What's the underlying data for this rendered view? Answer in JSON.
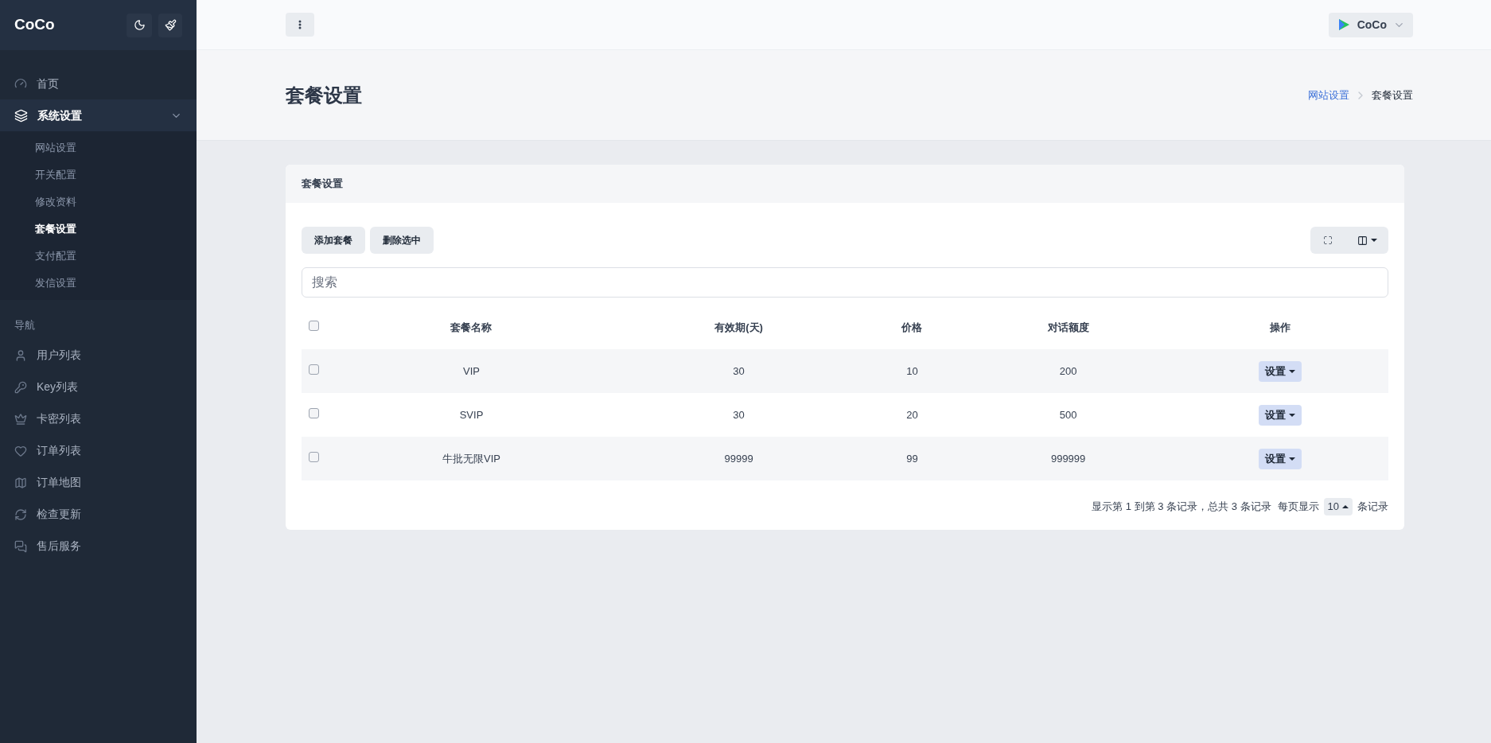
{
  "sidebar": {
    "brand": "CoCo",
    "items": [
      {
        "kind": "link",
        "label": "首页",
        "selected": false
      },
      {
        "kind": "group",
        "label": "系统设置",
        "expanded": true,
        "children": [
          {
            "label": "网站设置",
            "selected": false
          },
          {
            "label": "开关配置",
            "selected": false
          },
          {
            "label": "修改资料",
            "selected": false
          },
          {
            "label": "套餐设置",
            "selected": true
          },
          {
            "label": "支付配置",
            "selected": false
          },
          {
            "label": "发信设置",
            "selected": false
          }
        ]
      },
      {
        "kind": "heading",
        "label": "导航"
      },
      {
        "kind": "link",
        "label": "用户列表",
        "selected": false
      },
      {
        "kind": "link",
        "label": "Key列表",
        "selected": false
      },
      {
        "kind": "link",
        "label": "卡密列表",
        "selected": false
      },
      {
        "kind": "link",
        "label": "订单列表",
        "selected": false
      },
      {
        "kind": "link",
        "label": "订单地图",
        "selected": false
      },
      {
        "kind": "link",
        "label": "检查更新",
        "selected": false
      },
      {
        "kind": "link",
        "label": "售后服务",
        "selected": false
      }
    ]
  },
  "topbar": {
    "user": "CoCo"
  },
  "page": {
    "title": "套餐设置",
    "breadcrumb": [
      {
        "label": "网站设置",
        "link": true
      },
      {
        "label": "套餐设置",
        "link": false
      }
    ]
  },
  "card": {
    "title": "套餐设置",
    "buttons": [
      "添加套餐",
      "删除选中"
    ],
    "search": {
      "placeholder": "搜索"
    },
    "table": {
      "select_all": {
        "checked": false
      },
      "columns": [
        "套餐名称",
        "有效期(天)",
        "价格",
        "对话额度",
        "操作"
      ],
      "rows": [
        {
          "checked": false,
          "cells": [
            "VIP",
            "30",
            "10",
            "200"
          ],
          "action": "设置"
        },
        {
          "checked": false,
          "cells": [
            "SVIP",
            "30",
            "20",
            "500"
          ],
          "action": "设置"
        },
        {
          "checked": false,
          "cells": [
            "牛批无限VIP",
            "99999",
            "99",
            "999999"
          ],
          "action": "设置"
        }
      ]
    },
    "pagination": {
      "summary": "显示第 1 到第 3 条记录，总共 3 条记录",
      "per_page_label": "每页显示",
      "per_page": "10",
      "suffix": "条记录"
    }
  }
}
